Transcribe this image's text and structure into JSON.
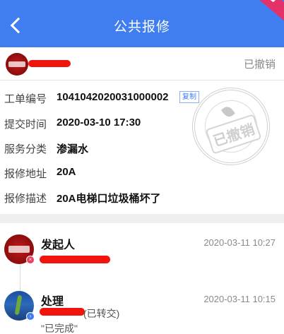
{
  "header": {
    "title": "公共报修"
  },
  "order": {
    "status_label": "已撤销",
    "stamp_text": "已撤销",
    "copy_label": "复制",
    "fields": [
      {
        "label": "工单编号",
        "value": "1041042020031000002"
      },
      {
        "label": "提交时间",
        "value": "2020-03-10 17:30"
      },
      {
        "label": "服务分类",
        "value": "渗漏水"
      },
      {
        "label": "报修地址",
        "value": "20A"
      },
      {
        "label": "报修描述",
        "value": "20A电梯口垃圾桶坏了"
      }
    ]
  },
  "timeline": {
    "events": [
      {
        "title": "发起人",
        "time": "2020-03-11 10:27",
        "badge_icon": "close-icon"
      },
      {
        "title": "处理",
        "time": "2020-03-11 10:15",
        "detail": "(已转交)",
        "note": "\"已完成\"",
        "badge_icon": "forward-icon"
      }
    ]
  },
  "colors": {
    "primary": "#3f7df0",
    "redaction": "#f0140c"
  }
}
